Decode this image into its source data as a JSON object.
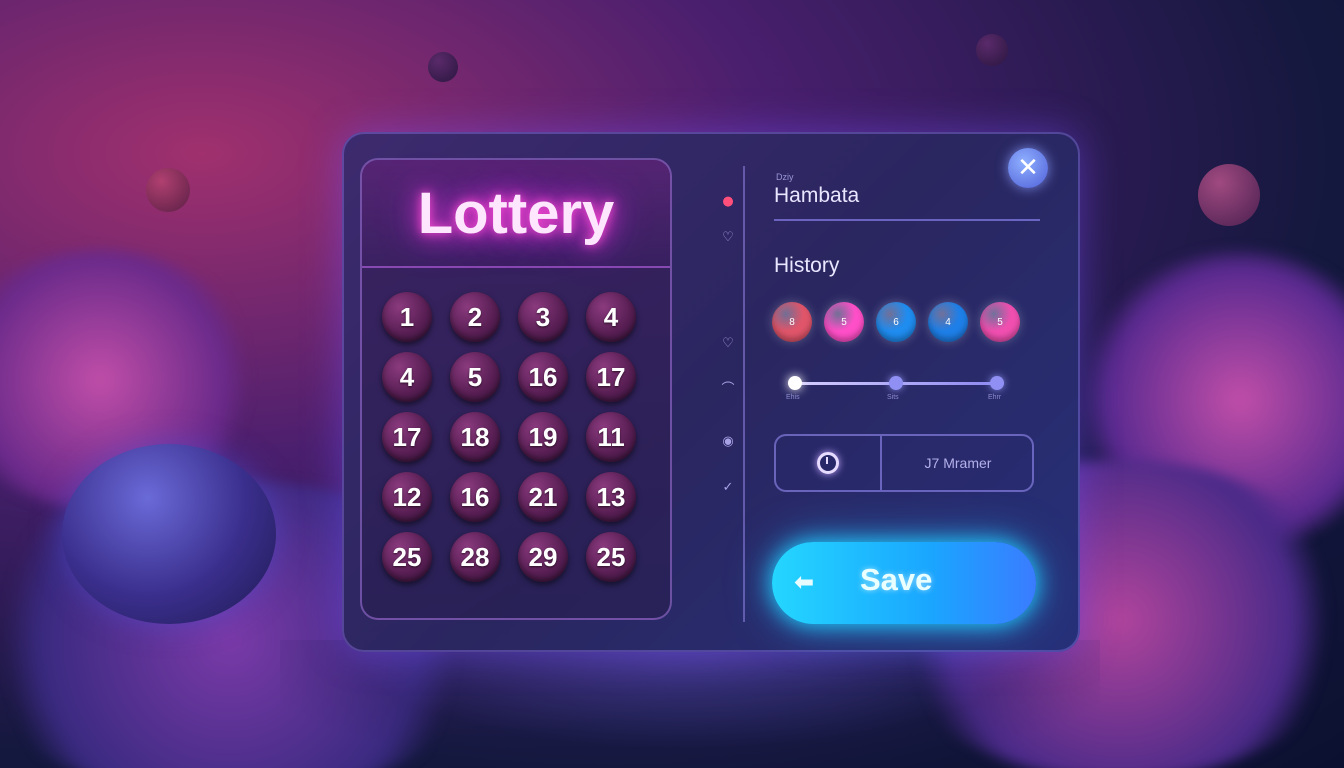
{
  "app": {
    "title": "Lottery"
  },
  "board": {
    "numbers": [
      "1",
      "2",
      "3",
      "4",
      "4",
      "5",
      "16",
      "17",
      "17",
      "18",
      "19",
      "11",
      "12",
      "16",
      "21",
      "13",
      "25",
      "28",
      "29",
      "25"
    ]
  },
  "side_icons": [
    {
      "name": "badge-one-icon",
      "glyph": "●"
    },
    {
      "name": "heart-icon",
      "glyph": "♡"
    },
    {
      "name": "heart-outline-icon",
      "glyph": "♡"
    },
    {
      "name": "arch-icon",
      "glyph": "⌒"
    },
    {
      "name": "eye-icon",
      "glyph": "◉"
    },
    {
      "name": "check-icon",
      "glyph": "✓"
    }
  ],
  "profile": {
    "small_label": "Dziy",
    "name": "Hambata"
  },
  "history": {
    "label": "History",
    "balls": [
      {
        "text": "8",
        "color": "#e0556a"
      },
      {
        "text": "5",
        "color": "#ff4fc8"
      },
      {
        "text": "6",
        "color": "#1f8cf0"
      },
      {
        "text": "4",
        "color": "#1e7fe8"
      },
      {
        "text": "5",
        "color": "#f04fb0"
      }
    ]
  },
  "slider": {
    "ticks": [
      "Ehis",
      "Sits",
      "Ehrr"
    ],
    "value_index": 0
  },
  "actions": {
    "timer_icon": "timer-icon",
    "right_label": "J7 Mramer"
  },
  "save": {
    "label": "Save",
    "arrow": "⬅"
  },
  "close": {
    "glyph": "✕"
  },
  "colors": {
    "title_glow": "#ff3ccf",
    "save_button": "#1ed0ff",
    "panel": "#2a2660"
  }
}
